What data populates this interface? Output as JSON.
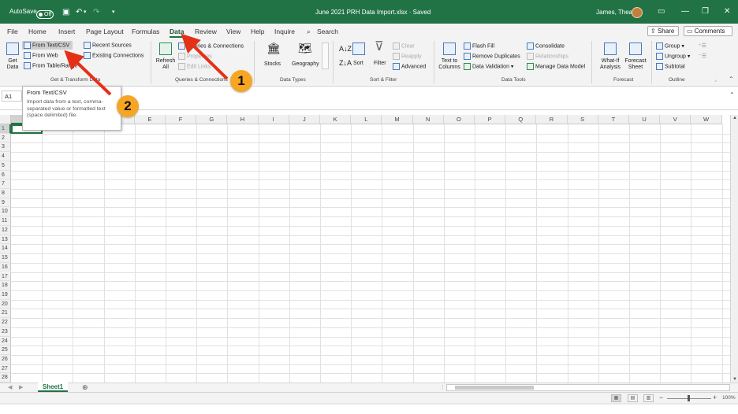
{
  "titlebar": {
    "autosave_label": "AutoSave",
    "autosave_state": "Off",
    "document_title": "June 2021 PRH Data Import.xlsx  ·  Saved",
    "user_name": "James, Thea"
  },
  "tabs": [
    "File",
    "Home",
    "Insert",
    "Page Layout",
    "Formulas",
    "Data",
    "Review",
    "View",
    "Help",
    "Inquire"
  ],
  "active_tab": "Data",
  "search_label": "Search",
  "share_label": "Share",
  "comments_label": "Comments",
  "ribbon": {
    "get_transform": {
      "get_data": "Get Data",
      "from_text_csv": "From Text/CSV",
      "from_web": "From Web",
      "from_table_range": "From Table/Range",
      "recent_sources": "Recent Sources",
      "existing_connections": "Existing Connections",
      "label": "Get & Transform Data"
    },
    "queries": {
      "refresh_all": "Refresh All",
      "queries_connections": "Queries & Connections",
      "properties": "Properties",
      "edit_links": "Edit Links",
      "label": "Queries & Connections"
    },
    "data_types": {
      "stocks": "Stocks",
      "geography": "Geography",
      "label": "Data Types"
    },
    "sort_filter": {
      "sort": "Sort",
      "filter": "Filter",
      "clear": "Clear",
      "reapply": "Reapply",
      "advanced": "Advanced",
      "label": "Sort & Filter"
    },
    "data_tools": {
      "text_to_columns": "Text to Columns",
      "flash_fill": "Flash Fill",
      "remove_duplicates": "Remove Duplicates",
      "data_validation": "Data Validation",
      "consolidate": "Consolidate",
      "relationships": "Relationships",
      "manage_data_model": "Manage Data Model",
      "label": "Data Tools"
    },
    "forecast": {
      "what_if": "What-If Analysis",
      "forecast_sheet": "Forecast Sheet",
      "label": "Forecast"
    },
    "outline": {
      "group": "Group",
      "ungroup": "Ungroup",
      "subtotal": "Subtotal",
      "label": "Outline"
    }
  },
  "formula_bar": {
    "name_box": "A1"
  },
  "tooltip": {
    "title": "From Text/CSV",
    "description": "Import data from a text, comma-separated value or formatted text (space delimited) file."
  },
  "grid": {
    "columns": [
      "A",
      "B",
      "C",
      "D",
      "E",
      "F",
      "G",
      "H",
      "I",
      "J",
      "K",
      "L",
      "M",
      "N",
      "O",
      "P",
      "Q",
      "R",
      "S",
      "T",
      "U",
      "V",
      "W"
    ],
    "rows": [
      "1",
      "2",
      "3",
      "4",
      "5",
      "6",
      "7",
      "8",
      "9",
      "10",
      "11",
      "12",
      "13",
      "14",
      "15",
      "16",
      "17",
      "18",
      "19",
      "20",
      "21",
      "22",
      "23",
      "24",
      "25",
      "26",
      "27",
      "28"
    ],
    "selected_cell": "A1"
  },
  "sheet_tab": "Sheet1",
  "zoom": "100%",
  "annotations": {
    "badge1": "1",
    "badge2": "2"
  },
  "colors": {
    "excel_green": "#217346",
    "badge_orange": "#f6a623",
    "arrow_red": "#e53018"
  }
}
